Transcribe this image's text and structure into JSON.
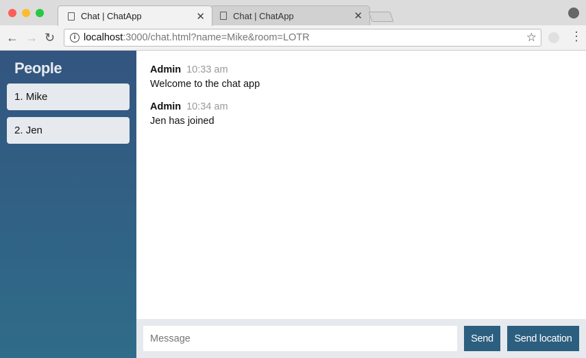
{
  "browser": {
    "tabs": [
      {
        "title": "Chat | ChatApp",
        "active": true
      },
      {
        "title": "Chat | ChatApp",
        "active": false
      }
    ],
    "url_host": "localhost",
    "url_rest": ":3000/chat.html?name=Mike&room=LOTR",
    "close_glyph": "✕"
  },
  "sidebar": {
    "title": "People",
    "people": [
      {
        "number": "1.",
        "name": "Mike"
      },
      {
        "number": "2.",
        "name": "Jen"
      }
    ]
  },
  "messages": [
    {
      "from": "Admin",
      "time": "10:33 am",
      "text": "Welcome to the chat app"
    },
    {
      "from": "Admin",
      "time": "10:34 am",
      "text": "Jen has joined"
    }
  ],
  "composer": {
    "placeholder": "Message",
    "send_label": "Send",
    "location_label": "Send location"
  },
  "colors": {
    "accent": "#2c5f7f",
    "sidebar_top": "#335580",
    "sidebar_bottom": "#2f6c89"
  }
}
